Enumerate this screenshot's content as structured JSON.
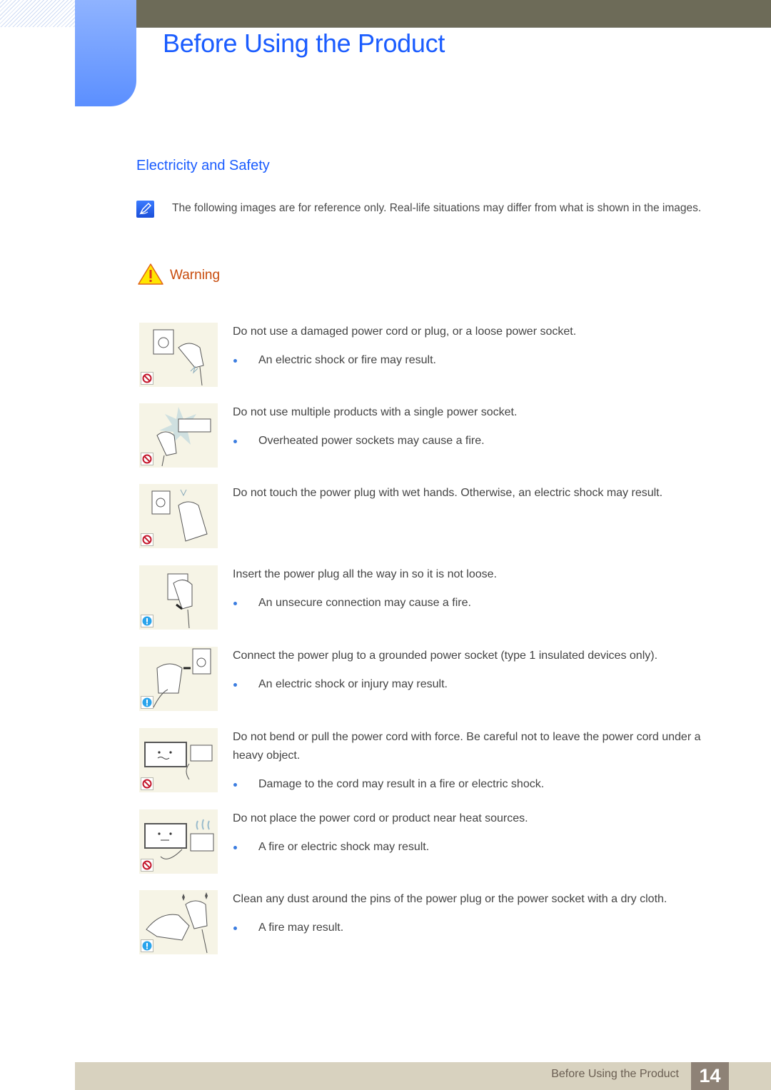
{
  "header": {
    "title": "Before Using the Product"
  },
  "section": {
    "title": "Electricity and Safety"
  },
  "note": {
    "icon": "note-pencil-icon",
    "text": "The following images are for reference only. Real-life situations may differ from what is shown in the images."
  },
  "warning": {
    "icon": "warning-triangle-icon",
    "label": "Warning"
  },
  "items": [
    {
      "badge": "prohibited",
      "illustration": "damaged-plug-illustration",
      "text": "Do not use a damaged power cord or plug, or a loose power socket.",
      "bullet": "An electric shock or fire may result."
    },
    {
      "badge": "prohibited",
      "illustration": "multi-socket-illustration",
      "text": "Do not use multiple products with a single power socket.",
      "bullet": "Overheated power sockets may cause a fire."
    },
    {
      "badge": "prohibited",
      "illustration": "wet-hands-plug-illustration",
      "text": "Do not touch the power plug with wet hands. Otherwise, an electric shock may result.",
      "bullet": ""
    },
    {
      "badge": "caution",
      "illustration": "insert-plug-illustration",
      "text": "Insert the power plug all the way in so it is not loose.",
      "bullet": "An unsecure connection may cause a fire."
    },
    {
      "badge": "caution",
      "illustration": "grounded-socket-illustration",
      "text": "Connect the power plug to a grounded power socket (type 1 insulated devices only).",
      "bullet": "An electric shock or injury may result."
    },
    {
      "badge": "prohibited",
      "illustration": "cord-under-object-illustration",
      "text": "Do not bend or pull the power cord with force. Be careful not to leave the power cord under a heavy object.",
      "bullet": "Damage to the cord may result in a fire or electric shock."
    },
    {
      "badge": "prohibited",
      "illustration": "heat-source-illustration",
      "text": "Do not place the power cord or product near heat sources.",
      "bullet": "A fire or electric shock may result."
    },
    {
      "badge": "caution",
      "illustration": "clean-plug-illustration",
      "text": "Clean any dust around the pins of the power plug or the power socket with a dry cloth.",
      "bullet": "A fire may result."
    }
  ],
  "footer": {
    "label": "Before Using the Product",
    "page_number": "14"
  },
  "colors": {
    "accent_blue": "#1a5cff",
    "warning_orange": "#c84b0c",
    "prohibited_red": "#c4172c",
    "caution_blue": "#2aa4ec",
    "bullet_blue": "#3b7de0"
  }
}
